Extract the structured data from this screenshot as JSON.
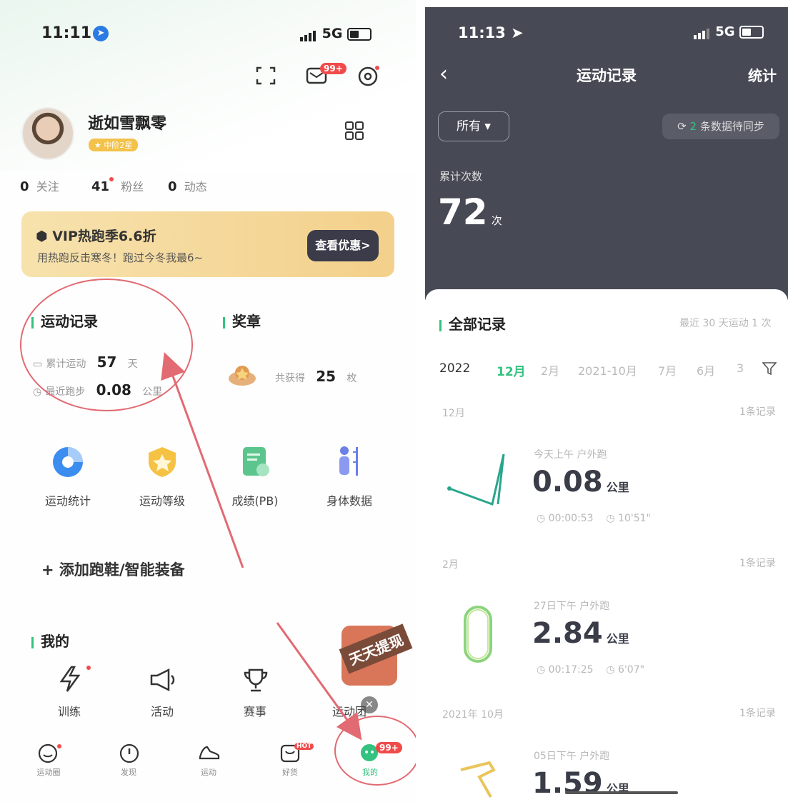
{
  "left": {
    "status_time": "11:11",
    "network": "5G",
    "msg_badge": "99+",
    "nickname": "逝如雪飘零",
    "level_badge": "中阶2星",
    "stats": [
      {
        "num": "0",
        "label": "关注"
      },
      {
        "num": "41",
        "label": "粉丝"
      },
      {
        "num": "0",
        "label": "动态"
      }
    ],
    "vip_title": "VIP热跑季6.6折",
    "vip_sub": "用热跑反击寒冬！跑过今冬我最6~",
    "vip_button": "查看优惠>",
    "records_title": "运动记录",
    "records_total_label": "累计运动",
    "records_total_value": "57",
    "records_total_unit": "天",
    "records_recent_label": "最近跑步",
    "records_recent_value": "0.08",
    "records_recent_unit": "公里",
    "medals_title": "奖章",
    "medals_label": "共获得",
    "medals_value": "25",
    "medals_unit": "枚",
    "grid": [
      "运动统计",
      "运动等级",
      "成绩(PB)",
      "身体数据"
    ],
    "add_label": "+ 添加跑鞋/智能装备",
    "mine_title": "我的",
    "mine_items": [
      "训练",
      "活动",
      "赛事",
      "运动团"
    ],
    "promo_tag": "天天提现",
    "nav": [
      "运动圈",
      "发现",
      "运动",
      "好货",
      "我的"
    ],
    "nav_badge": "99+",
    "nav_hot": "HOT",
    "accent": "#33c27f",
    "annotation_color": "#e26a72"
  },
  "right": {
    "status_time": "11:13",
    "network": "5G",
    "title": "运动记录",
    "stats_link": "统计",
    "filter": "所有 ▾",
    "sync_count": "2",
    "sync_text": "条数据待同步",
    "total_label": "累计次数",
    "total_value": "72",
    "total_unit": "次",
    "all_title": "全部记录",
    "recent_summary": "最近 30 天运动 1 次",
    "year": "2022",
    "months": [
      "12月",
      "2月",
      "2021-10月",
      "7月",
      "6月",
      "3"
    ],
    "records": [
      {
        "month": "12月",
        "count": "1条记录",
        "when": "今天上午 户外跑",
        "distance": "0.08",
        "unit": "公里",
        "duration": "00:00:53",
        "pace": "10'51\""
      },
      {
        "month": "2月",
        "count": "1条记录",
        "when": "27日下午 户外跑",
        "distance": "2.84",
        "unit": "公里",
        "duration": "00:17:25",
        "pace": "6'07\""
      },
      {
        "month": "2021年 10月",
        "count": "1条记录",
        "when": "05日下午 户外跑",
        "distance": "1.59",
        "unit": "公里",
        "duration": "",
        "pace": ""
      }
    ],
    "header_bg": "#474a55"
  }
}
